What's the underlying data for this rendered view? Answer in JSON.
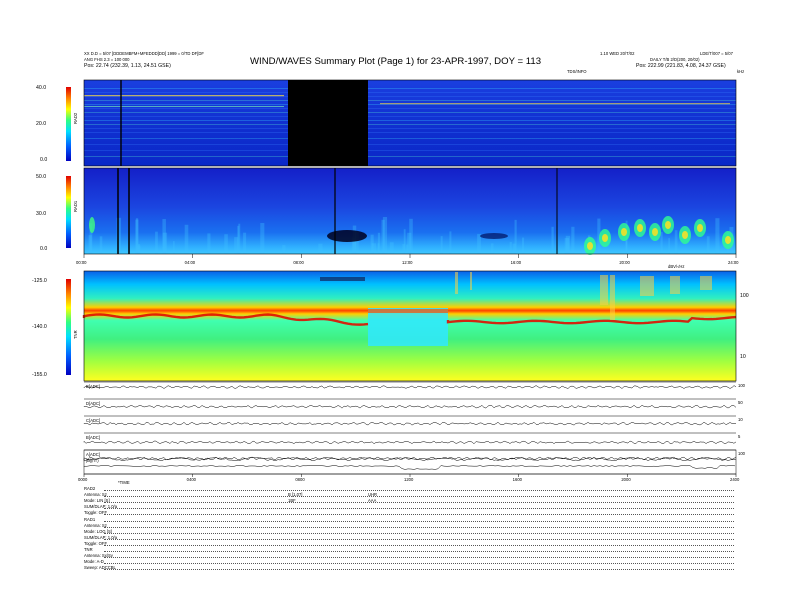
{
  "header": {
    "left_line1": "XX D.D = 5/07 [DDDEMBFM+MFEDDD]DD] 1999 = 0/TD DF[DF",
    "left_line2": "ANG FHS 2.3 = 100 000",
    "left_line3": "Pos: 22.74 (232.39, 1.13, 24.51 GSE)",
    "title": "WIND/WAVES Summary Plot (Page 1) for 23-APR-1997, DOY = 113",
    "right_line1": "1.10 WED 20/T/02",
    "right_line1b": "LDE/T/007 = 5/07",
    "right_line2": "DAILY  T/B 2/D(200, 20/02)",
    "right_line3": "Pos: 222.99 (221.83, 4.08, 24.37 GSE)",
    "tdsinfo": "TDS/INFO",
    "khz_label": "kHz",
    "mhz_label": "MHz"
  },
  "rad2": {
    "ylabel": "RAD2",
    "ticks": [
      "40.0",
      "20.0",
      "0.0"
    ]
  },
  "rad1": {
    "ylabel": "RAD1",
    "ticks": [
      "50.0",
      "30.0",
      "0.0"
    ]
  },
  "tnr": {
    "ylabel": "TNR",
    "ticks": [
      "-125.0",
      "-140.0",
      "-155.0"
    ],
    "right_ticks": [
      "100",
      "10"
    ],
    "top_right": "dBV/√Hz"
  },
  "time_axis_mid": [
    "00:00",
    "04:00",
    "08:00",
    "12:00",
    "16:00",
    "20:00",
    "24:00"
  ],
  "time_axis_bottom": [
    "0000",
    "0400",
    "0800",
    "1200",
    "1600",
    "2000",
    "2400"
  ],
  "bottom_label": "*TIME",
  "chart_data": {
    "type": "line",
    "title": "WIND/WAVES Summary Plot (Page 1) for 23-APR-1997, DOY = 113",
    "xlabel": "",
    "x_ticks_hours": [
      0,
      4,
      8,
      12,
      16,
      20,
      24
    ],
    "series": [
      {
        "name": "B[ADC]",
        "baseline": 0.7
      },
      {
        "name": "D[ADC]",
        "baseline": 0.55
      },
      {
        "name": "C[ADC]",
        "baseline": 0.55
      },
      {
        "name": "B[ADC]",
        "baseline": 0.45
      },
      {
        "name": "A[ADC]",
        "baseline": 0.5
      },
      {
        "name": "|B|(nT)",
        "baseline": 0.45
      }
    ],
    "line_ticks": [
      "100",
      "50",
      "10",
      "5"
    ],
    "rad2_range": [
      0,
      40
    ],
    "rad1_range": [
      0,
      50
    ],
    "tnr_range": [
      -155,
      -125
    ]
  },
  "footer": {
    "rad2_lines": [
      "RAD2",
      "Antenna:   Sz",
      "Mode:   LIN [S]",
      "SUM/DLAP: 1.0/a",
      "Toggle:   OFF"
    ],
    "rad1_lines": [
      "RAD1",
      "Antenna:   Sz",
      "Mode:   LOG [S]",
      "SUM/DLAP: 1.0/a",
      "Toggle:   OFF"
    ],
    "tnr_lines": [
      "TNR",
      "Antenna:   Sx/Sy",
      "Mode:   A-D",
      "Sweep:   ADCCBL"
    ],
    "mid_a": "B [1.07]",
    "mid_b": "1BF",
    "mid_c": "UHR",
    "mid_d": "AAA"
  }
}
